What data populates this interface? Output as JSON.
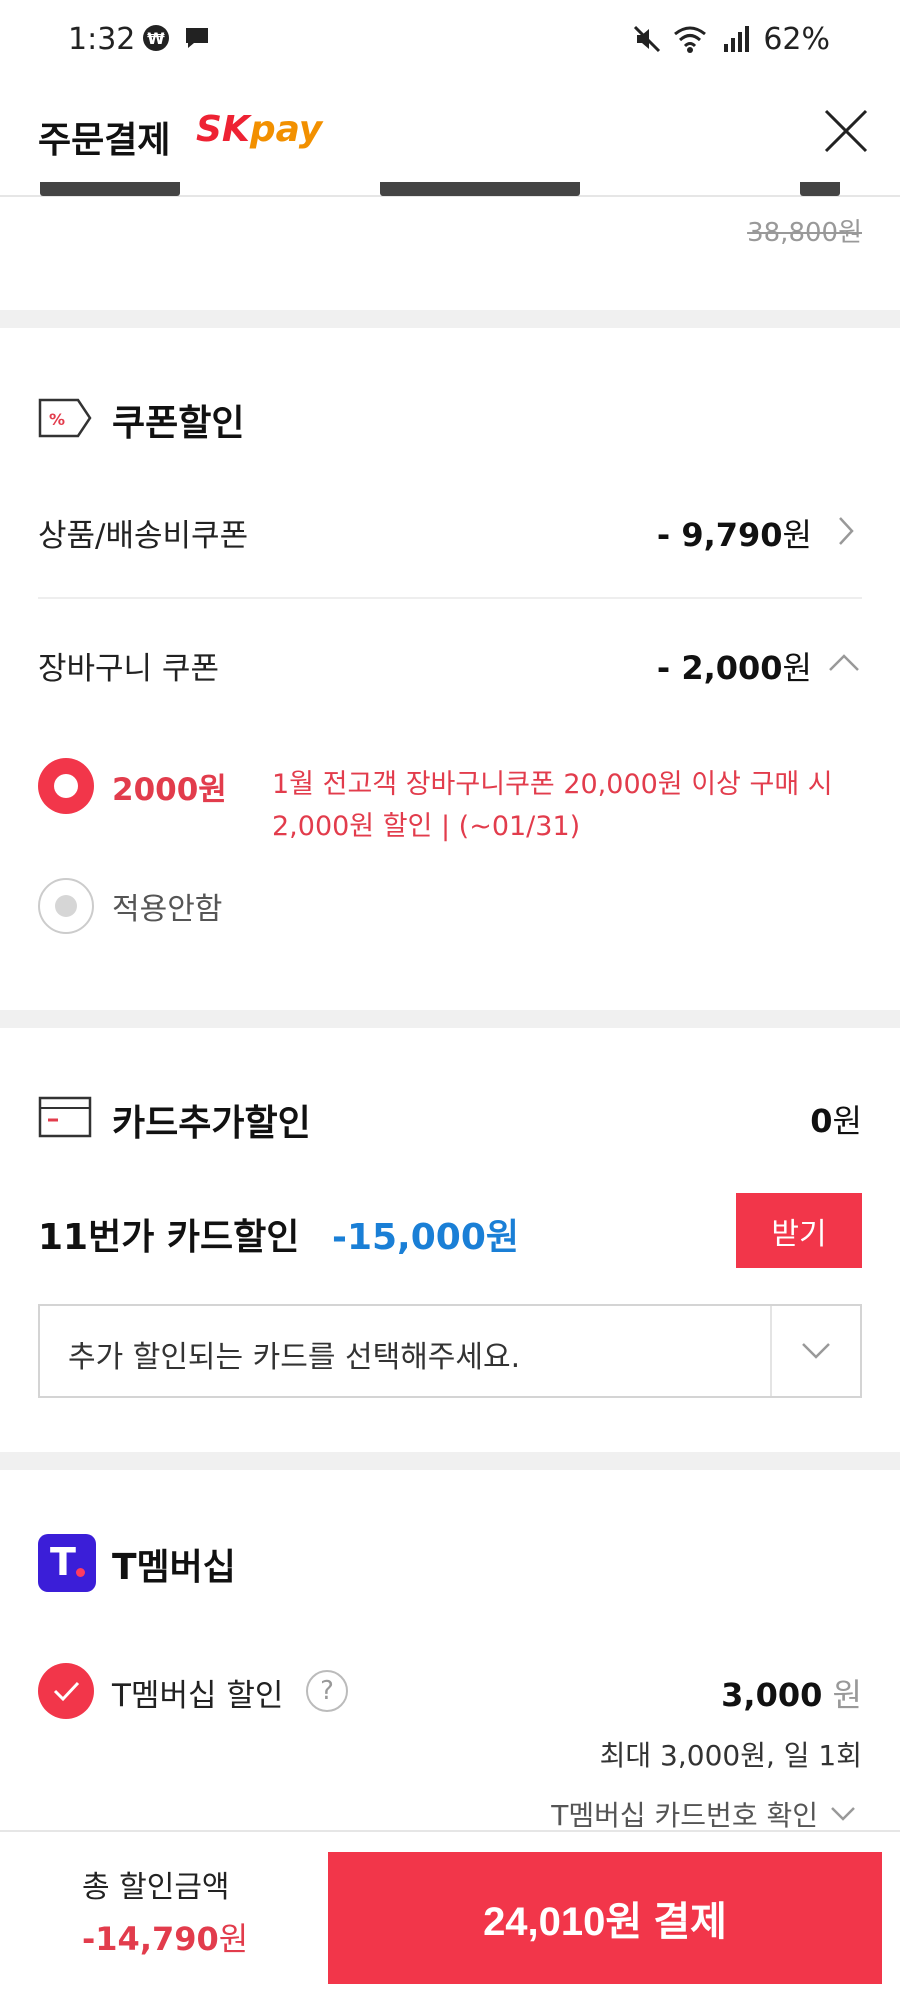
{
  "status_bar": {
    "time": "1:32",
    "battery": "62%",
    "icons": [
      "won-app-icon",
      "chat-icon",
      "mute-icon",
      "wifi-icon",
      "signal-icon"
    ]
  },
  "header": {
    "title": "주문결제",
    "logo_sk": "SK",
    "logo_pay": "pay",
    "close_icon": "close-icon"
  },
  "top_fragment": {
    "original_price": "38,800원"
  },
  "coupon": {
    "title": "쿠폰할인",
    "product_shipping_label": "상품/배송비쿠폰",
    "product_shipping_amount": "- 9,790",
    "cart_label": "장바구니 쿠폰",
    "cart_amount": "- 2,000",
    "won": "원",
    "option_selected_value": "2000원",
    "option_selected_desc": "1월 전고객 장바구니쿠폰 20,000원 이상 구매 시 2,000원 할인 | (~01/31)",
    "option_none_label": "적용안함"
  },
  "card": {
    "title": "카드추가할인",
    "amount_num": "0",
    "won": "원",
    "promo_label": "11번가 카드할인",
    "promo_amount": "-15,000원",
    "receive_button": "받기",
    "select_placeholder": "추가 할인되는 카드를 선택해주세요."
  },
  "tmembership": {
    "logo_letter": "T",
    "title": "T멤버십",
    "discount_label": "T멤버십 할인",
    "help": "?",
    "discount_amount": "3,000",
    "won": "원",
    "limit_note": "최대 3,000원, 일 1회",
    "card_check_link": "T멤버십 카드번호 확인"
  },
  "footer": {
    "total_label": "총 할인금액",
    "total_amount": "-14,790",
    "won": "원",
    "pay_button": "24,010원 결제"
  },
  "colors": {
    "accent_red": "#f2364a",
    "text_red": "#e23c4c",
    "promo_blue": "#1a7fd6",
    "tmember_purple": "#3b1ed8"
  }
}
